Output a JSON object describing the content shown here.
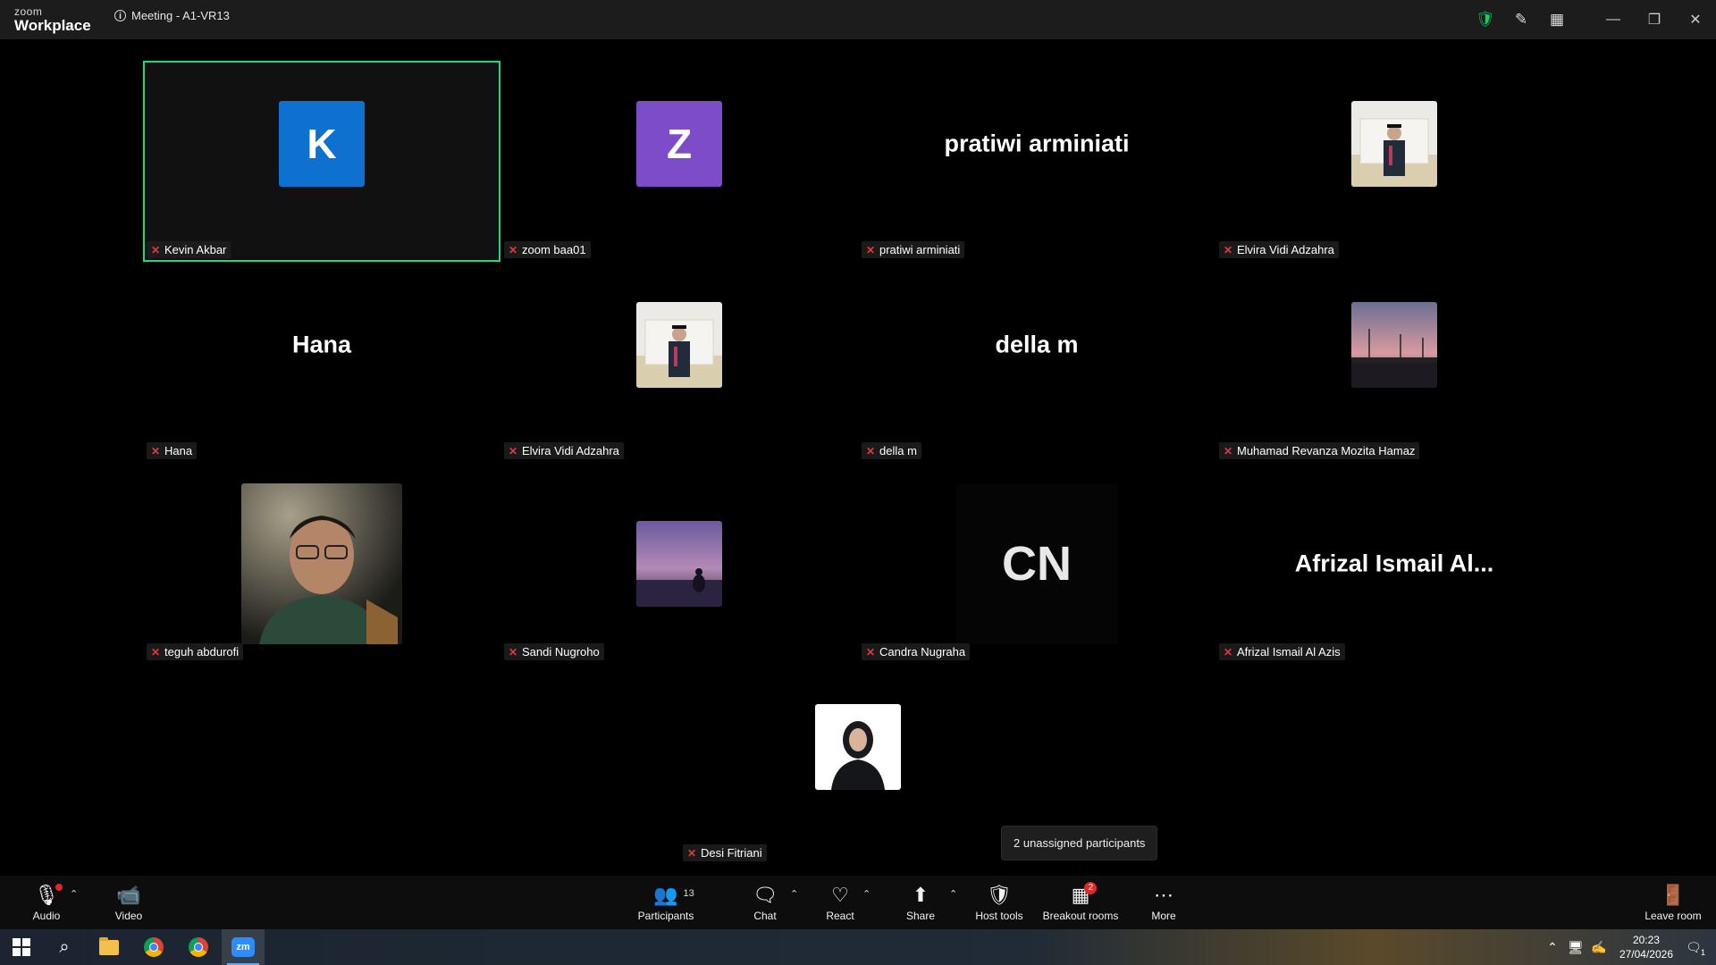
{
  "app": {
    "logo_line1": "zoom",
    "logo_line2": "Workplace"
  },
  "meeting": {
    "title": "Meeting - A1-VR13"
  },
  "titlebar_icons": [
    "security-shield-icon",
    "annotate-pen-icon",
    "apps-grid-icon"
  ],
  "window_controls": [
    "minimize",
    "restore",
    "close"
  ],
  "tiles": [
    {
      "name": "Kevin Akbar",
      "display": "letter",
      "letter": "K",
      "color": "#0e71d0",
      "active": true,
      "muted": true
    },
    {
      "name": "zoom baa01",
      "display": "letter",
      "letter": "Z",
      "color": "#7d4cc8",
      "muted": true
    },
    {
      "name": "pratiwi arminiati",
      "display": "name",
      "big_name": "pratiwi arminiati",
      "muted": true
    },
    {
      "name": "Elvira Vidi Adzahra",
      "display": "photo",
      "photo": "graduation portrait",
      "muted": true
    },
    {
      "name": "Hana",
      "display": "name",
      "big_name": "Hana",
      "muted": true
    },
    {
      "name": "Elvira Vidi Adzahra",
      "display": "photo",
      "photo": "graduation portrait",
      "muted": true
    },
    {
      "name": "della m",
      "display": "name",
      "big_name": "della m",
      "muted": true
    },
    {
      "name": "Muhamad Revanza Mozita Hamaz",
      "display": "photo",
      "photo": "sunset city bridge",
      "muted": true
    },
    {
      "name": "teguh abdurofi",
      "display": "photo",
      "photo": "man with glasses portrait",
      "muted": true
    },
    {
      "name": "Sandi Nugroho",
      "display": "photo",
      "photo": "purple sunset sea silhouette",
      "muted": true
    },
    {
      "name": "Candra Nugraha",
      "display": "initials",
      "initials": "CN",
      "muted": true
    },
    {
      "name": "Afrizal Ismail Al Azis",
      "display": "name",
      "big_name": "Afrizal Ismail Al...",
      "muted": true
    },
    {
      "name": "Desi Fitriani",
      "display": "photo",
      "photo": "woman in hijab portrait",
      "muted": true
    }
  ],
  "toolbar": {
    "audio": "Audio",
    "video": "Video",
    "participants": "Participants",
    "participants_count": "13",
    "chat": "Chat",
    "react": "React",
    "share": "Share",
    "host_tools": "Host tools",
    "breakout_rooms": "Breakout rooms",
    "breakout_badge": "2",
    "more": "More",
    "leave_room": "Leave room"
  },
  "tooltip": {
    "text": "2 unassigned participants"
  },
  "taskbar": {
    "apps": [
      "start-icon",
      "search-icon",
      "file-explorer-icon",
      "chrome-icon",
      "chrome-profile-icon",
      "zoom-icon"
    ],
    "time": "20:23",
    "date": "27/04/2026",
    "notification_count": "1"
  }
}
